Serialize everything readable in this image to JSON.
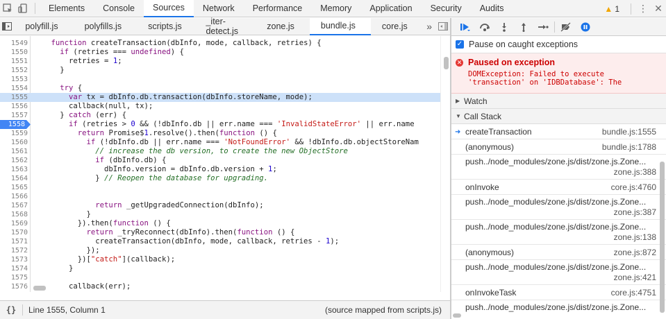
{
  "topbar": {
    "tabs": [
      "Elements",
      "Console",
      "Sources",
      "Network",
      "Performance",
      "Memory",
      "Application",
      "Security",
      "Audits"
    ],
    "active_tab": "Sources",
    "warning_count": "1"
  },
  "files": {
    "tabs": [
      "polyfill.js",
      "polyfills.js",
      "scripts.js",
      "_iter-detect.js",
      "zone.js",
      "bundle.js",
      "core.js"
    ],
    "active": "bundle.js"
  },
  "editor": {
    "lines": [
      {
        "n": "1549",
        "t": "    function createTransaction(dbInfo, mode, callback, retries) {"
      },
      {
        "n": "1550",
        "t": "      if (retries === undefined) {"
      },
      {
        "n": "1551",
        "t": "        retries = 1;"
      },
      {
        "n": "1552",
        "t": "      }"
      },
      {
        "n": "1553",
        "t": ""
      },
      {
        "n": "1554",
        "t": "      try {"
      },
      {
        "n": "1555",
        "t": "        var tx = dbInfo.db.transaction(dbInfo.storeName, mode);"
      },
      {
        "n": "1556",
        "t": "        callback(null, tx);"
      },
      {
        "n": "1557",
        "t": "      } catch (err) {"
      },
      {
        "n": "1558",
        "t": "        if (retries > 0 && (!dbInfo.db || err.name === 'InvalidStateError' || err.name"
      },
      {
        "n": "1559",
        "t": "          return Promise$1.resolve().then(function () {"
      },
      {
        "n": "1560",
        "t": "            if (!dbInfo.db || err.name === 'NotFoundError' && !dbInfo.db.objectStoreNam"
      },
      {
        "n": "1561",
        "t": "              // increase the db version, to create the new ObjectStore"
      },
      {
        "n": "1562",
        "t": "              if (dbInfo.db) {"
      },
      {
        "n": "1563",
        "t": "                dbInfo.version = dbInfo.db.version + 1;"
      },
      {
        "n": "1564",
        "t": "              } // Reopen the database for upgrading."
      },
      {
        "n": "1565",
        "t": ""
      },
      {
        "n": "1566",
        "t": ""
      },
      {
        "n": "1567",
        "t": "              return _getUpgradedConnection(dbInfo);"
      },
      {
        "n": "1568",
        "t": "            }"
      },
      {
        "n": "1569",
        "t": "          }).then(function () {"
      },
      {
        "n": "1570",
        "t": "            return _tryReconnect(dbInfo).then(function () {"
      },
      {
        "n": "1571",
        "t": "              createTransaction(dbInfo, mode, callback, retries - 1);"
      },
      {
        "n": "1572",
        "t": "            });"
      },
      {
        "n": "1573",
        "t": "          })[\"catch\"](callback);"
      },
      {
        "n": "1574",
        "t": "        }"
      },
      {
        "n": "1575",
        "t": ""
      },
      {
        "n": "1576",
        "t": "        callback(err);"
      },
      {
        "n": "1577",
        "t": ""
      }
    ]
  },
  "status": {
    "braces": "{}",
    "position": "Line 1555, Column 1",
    "mapped": "(source mapped from scripts.js)"
  },
  "debugger": {
    "pause_caught_label": "Pause on caught exceptions",
    "exception_title": "Paused on exception",
    "exception_message_1": "DOMException: Failed to execute",
    "exception_message_2": "'transaction' on 'IDBDatabase': The",
    "watch_label": "Watch",
    "callstack_label": "Call Stack",
    "frames": [
      {
        "name": "createTransaction",
        "loc": "bundle.js:1555",
        "current": true,
        "two_line": false
      },
      {
        "name": "(anonymous)",
        "loc": "bundle.js:1788",
        "two_line": false
      },
      {
        "name": "push../node_modules/zone.js/dist/zone.js.Zone...",
        "loc": "zone.js:388",
        "two_line": true
      },
      {
        "name": "onInvoke",
        "loc": "core.js:4760",
        "two_line": false
      },
      {
        "name": "push../node_modules/zone.js/dist/zone.js.Zone...",
        "loc": "zone.js:387",
        "two_line": true
      },
      {
        "name": "push../node_modules/zone.js/dist/zone.js.Zone...",
        "loc": "zone.js:138",
        "two_line": true
      },
      {
        "name": "(anonymous)",
        "loc": "zone.js:872",
        "two_line": false
      },
      {
        "name": "push../node_modules/zone.js/dist/zone.js.Zone...",
        "loc": "zone.js:421",
        "two_line": true
      },
      {
        "name": "onInvokeTask",
        "loc": "core.js:4751",
        "two_line": false
      },
      {
        "name": "push../node_modules/zone.js/dist/zone.js.Zone...",
        "loc": "",
        "two_line": true
      }
    ]
  },
  "colors": {
    "accent": "#1a73e8",
    "exec_line": "#cde1f9",
    "exception_bg": "#fdeded",
    "exception_text": "#cc0000",
    "keyword": "#881280",
    "string": "#c41a16",
    "comment": "#236e25"
  }
}
